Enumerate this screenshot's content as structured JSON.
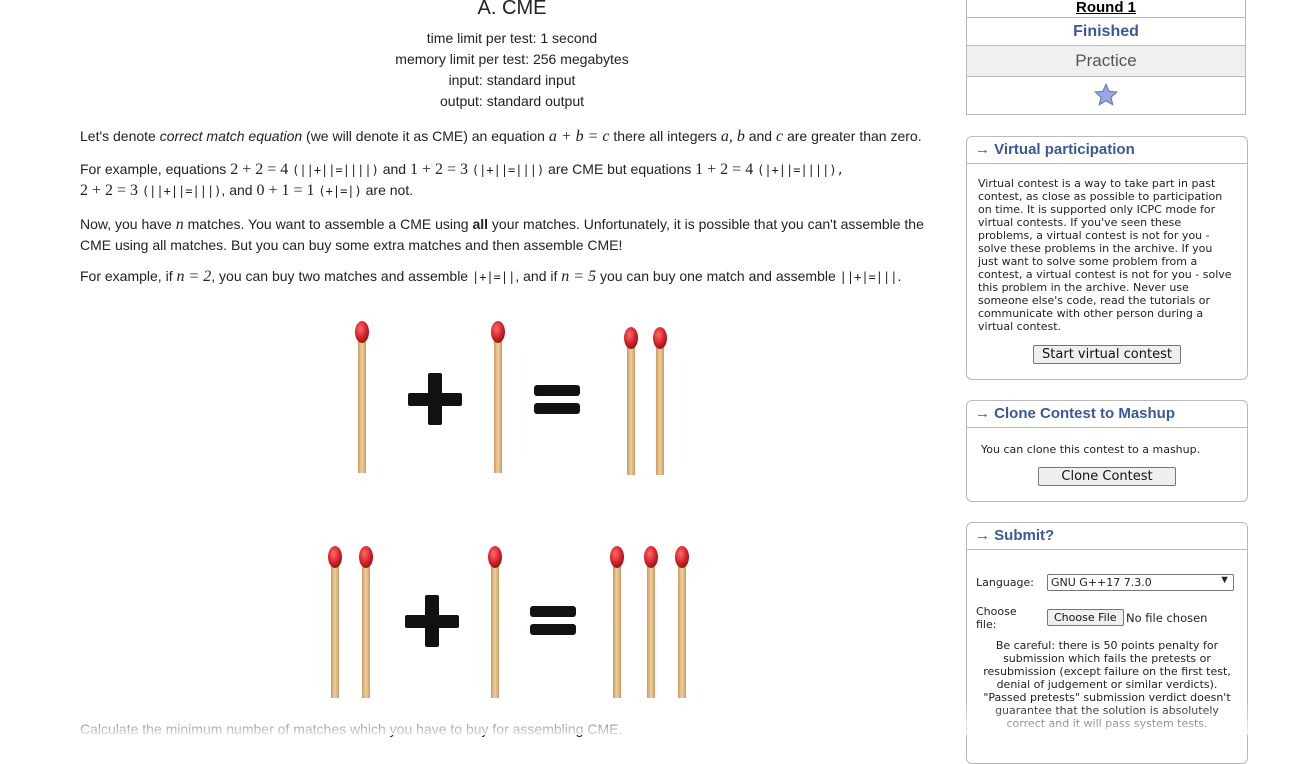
{
  "problem": {
    "title": "A. CME",
    "limits": [
      "time limit per test: 1 second",
      "memory limit per test: 256 megabytes",
      "input: standard input",
      "output: standard output"
    ],
    "p1_pre": "Let's denote ",
    "p1_em": "correct match equation",
    "p1_mid": " (we will denote it as CME) an equation ",
    "p1_math": "a + b = c",
    "p1_post_a": " there all integers ",
    "p1_vars": "a, b",
    "p1_and": " and ",
    "p1_c": "c",
    "p1_end": " are greater than zero.",
    "p2_pre": "For example, equations ",
    "p2_eq1": "2 + 2 = 4",
    "p2_st1": "(||+||=||||)",
    "p2_and1": " and ",
    "p2_eq2": "1 + 2 = 3",
    "p2_st2": "(|+||=|||)",
    "p2_mid": " are CME but equations ",
    "p2_eq3": "1 + 2 = 4",
    "p2_st3": "(|+||=||||),",
    "p2_eq4": "2 + 2 = 3",
    "p2_st4": "(||+||=|||)",
    "p2_and2": ", and ",
    "p2_eq5": "0 + 1 = 1",
    "p2_st5": "(+|=|)",
    "p2_end": " are not.",
    "p3_a": "Now, you have ",
    "p3_n": "n",
    "p3_b": " matches. You want to assemble a CME using ",
    "p3_all": "all",
    "p3_c": " your matches. Unfortunately, it is possible that you can't assemble the CME using all matches. But you can buy some extra matches and then assemble CME!",
    "p4_a": "For example, if ",
    "p4_m1": "n = 2",
    "p4_b": ", you can buy two matches and assemble ",
    "p4_s1": "|+|=||",
    "p4_c": ", and if ",
    "p4_m2": "n = 5",
    "p4_d": " you can buy one match and assemble ",
    "p4_s2": "||+|=|||",
    "p4_e": ".",
    "p5": "Calculate the minimum number of matches which you have to buy for assembling CME."
  },
  "sidebar": {
    "round": {
      "name": "Round 1",
      "status": "Finished",
      "practice": "Practice",
      "star_icon": "star-icon"
    },
    "virtual": {
      "caption": "→ Virtual participation",
      "text": "Virtual contest is a way to take part in past contest, as close as possible to participation on time. It is supported only ICPC mode for virtual contests. If you've seen these problems, a virtual contest is not for you - solve these problems in the archive. If you just want to solve some problem from a contest, a virtual contest is not for you - solve this problem in the archive. Never use someone else's code, read the tutorials or communicate with other person during a virtual contest.",
      "button": "Start virtual contest"
    },
    "clone": {
      "caption": "→ Clone Contest to Mashup",
      "text": "You can clone this contest to a mashup.",
      "button": "Clone Contest"
    },
    "submit": {
      "caption": "→ Submit?",
      "language_label": "Language:",
      "language_value": "GNU G++17 7.3.0",
      "file_label": "Choose file:",
      "file_button": "Choose File",
      "file_status": "No file chosen",
      "warning": "Be careful: there is 50 points penalty for submission which fails the pretests or resubmission (except failure on the first test, denial of judgement or similar verdicts). \"Passed pretests\" submission verdict doesn't guarantee that the solution is absolutely correct and it will pass system tests."
    }
  },
  "colors": {
    "accent": "#3b5998",
    "match_wood": "#e8c493",
    "match_head": "#d2232a"
  }
}
